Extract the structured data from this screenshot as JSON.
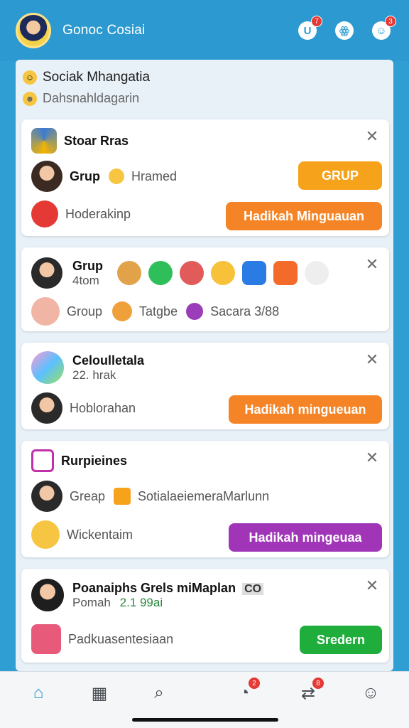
{
  "app": {
    "title": "Gonoc Cosiai"
  },
  "top_icons": [
    {
      "name": "notification-icon",
      "badge": "7"
    },
    {
      "name": "friends-icon",
      "badge": ""
    },
    {
      "name": "messages-icon",
      "badge": "3"
    }
  ],
  "header": {
    "line1": "Sociak Mhangatia",
    "line2": "Dahsnahldagarin"
  },
  "cards": [
    {
      "title": "Stoar Rras",
      "row1_label": "Grup",
      "row1_sub": "Hramed",
      "row1_button": "GRUP",
      "row2_label": "Hoderakinp",
      "row2_button": "Hadikah Minguauan"
    },
    {
      "title": "Grup",
      "subtitle": "4tom",
      "row2_label": "Group",
      "row2_mid": "Tatgbe",
      "row2_right": "Sacara 3/88"
    },
    {
      "title": "Celoulletala",
      "subtitle": "22. hrak",
      "row2_label": "Hoblorahan",
      "row2_button": "Hadikah mingueuan"
    },
    {
      "title": "Rurpieines",
      "row1_label": "Greap",
      "row1_text": "SotialaeiemeraMarlunn",
      "row2_label": "Wickentaim",
      "row2_button": "Hadikah mingeuaa"
    },
    {
      "title": "Poanaiphs Grels miMaplan",
      "title_tag": "CO",
      "subtitle": "Pomah",
      "sub_extra": "2.1 99ai",
      "row2_label": "Padkuasentesiaan",
      "row2_button": "Sredern"
    }
  ],
  "nav": [
    {
      "name": "home-icon",
      "badge": ""
    },
    {
      "name": "news-icon",
      "badge": ""
    },
    {
      "name": "search-icon",
      "badge": ""
    },
    {
      "name": "chat-icon",
      "badge": "2"
    },
    {
      "name": "share-icon",
      "badge": "8"
    },
    {
      "name": "profile-icon",
      "badge": ""
    }
  ],
  "colors": {
    "brand": "#2c9ad0",
    "orange": "#f58426",
    "yellow_orange": "#f7a21b",
    "purple": "#a035b8",
    "green": "#1fae3c"
  }
}
